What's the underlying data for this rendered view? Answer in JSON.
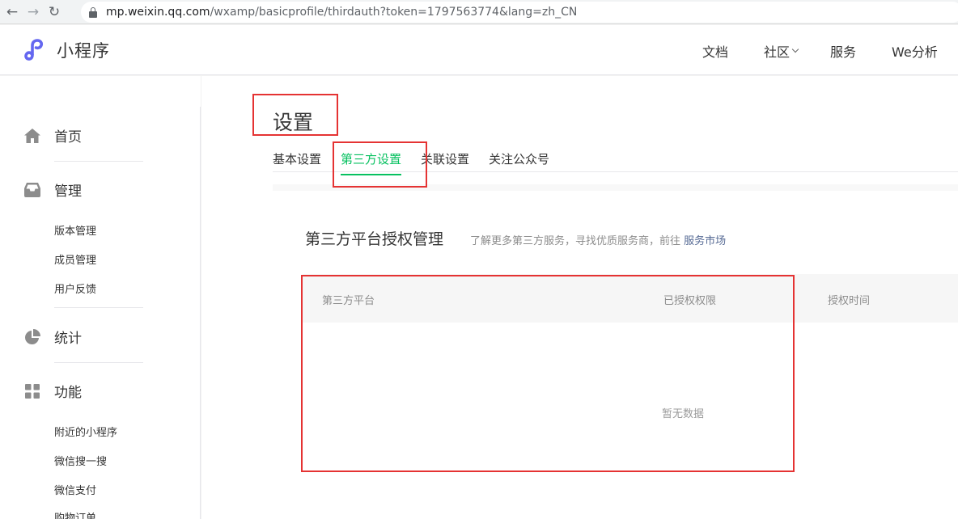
{
  "browser": {
    "url_host": "mp.weixin.qq.com",
    "url_path": "/wxamp/basicprofile/thirdauth?token=1797563774&lang=zh_CN"
  },
  "header": {
    "logo_text": "小程序",
    "nav": [
      "文档",
      "社区",
      "服务",
      "We分析"
    ]
  },
  "sidebar": {
    "home": "首页",
    "manage": {
      "label": "管理",
      "items": [
        "版本管理",
        "成员管理",
        "用户反馈"
      ]
    },
    "stats": "统计",
    "features": {
      "label": "功能",
      "items": [
        "附近的小程序",
        "微信搜一搜",
        "微信支付",
        "购物订单"
      ]
    }
  },
  "main": {
    "title": "设置",
    "tabs": [
      "基本设置",
      "第三方设置",
      "关联设置",
      "关注公众号"
    ],
    "active_tab": "第三方设置",
    "card": {
      "title": "第三方平台授权管理",
      "desc": "了解更多第三方服务，寻找优质服务商，前往",
      "desc_link": "服务市场",
      "columns": [
        "第三方平台",
        "已授权权限",
        "授权时间"
      ],
      "empty_text": "暂无数据"
    }
  },
  "colors": {
    "accent": "#07c160",
    "annotation": "#e53333",
    "link": "#576b95",
    "logo": "#6467f0"
  }
}
